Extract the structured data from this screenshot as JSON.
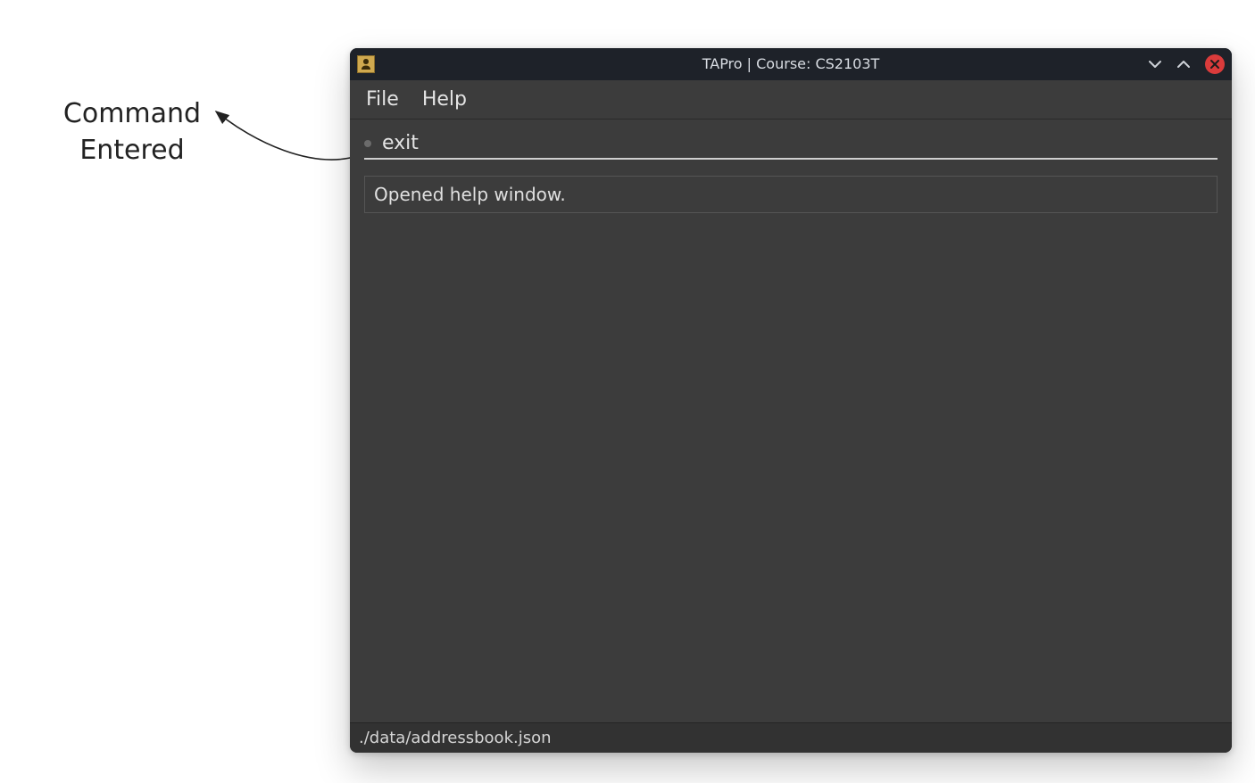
{
  "annotation": {
    "line1": "Command",
    "line2": "Entered"
  },
  "window": {
    "title": "TAPro | Course: CS2103T"
  },
  "menu": {
    "file": "File",
    "help": "Help"
  },
  "command": {
    "value": "exit"
  },
  "result": {
    "text": "Opened help window."
  },
  "statusbar": {
    "path": "./data/addressbook.json"
  }
}
